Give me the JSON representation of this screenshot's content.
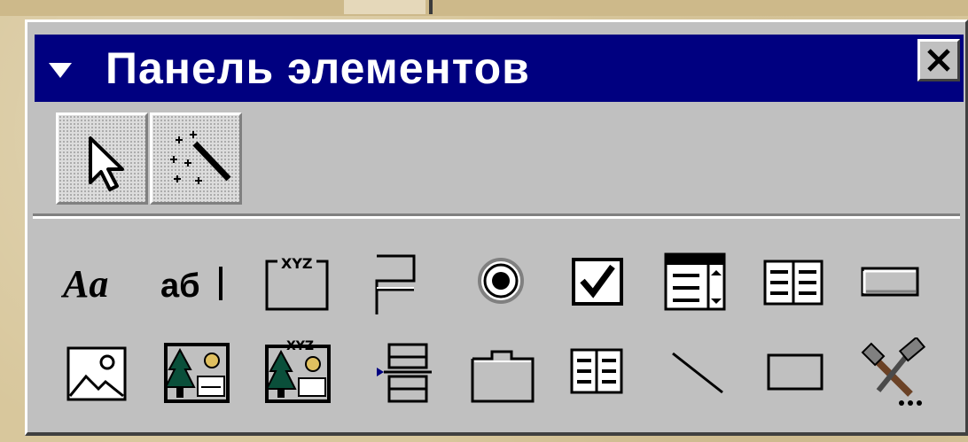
{
  "window": {
    "title": "Панель элементов"
  },
  "icons": {
    "menu": "menu-arrow-icon",
    "close": "close-icon"
  },
  "colors": {
    "titlebar": "#000080",
    "face": "#c0c0c0",
    "highlight": "#ffffff",
    "shadow": "#404040"
  },
  "toolbox": {
    "selection_tools": [
      {
        "name": "select-objects",
        "icon": "select-arrow-icon",
        "state": "pressed"
      },
      {
        "name": "control-wizards",
        "icon": "control-wizard-icon",
        "state": "pressed"
      }
    ],
    "tool_rows": [
      [
        "label-icon",
        "text-box-icon",
        "option-group-icon",
        "toggle-button-icon",
        "option-button-icon",
        "check-box-icon",
        "combo-box-icon",
        "list-box-icon",
        "command-button-icon"
      ],
      [
        "image-icon",
        "unbound-object-frame-icon",
        "bound-object-frame-icon",
        "page-break-icon",
        "tab-control-icon",
        "subform-icon",
        "line-icon",
        "rectangle-icon",
        "more-controls-icon"
      ]
    ]
  }
}
